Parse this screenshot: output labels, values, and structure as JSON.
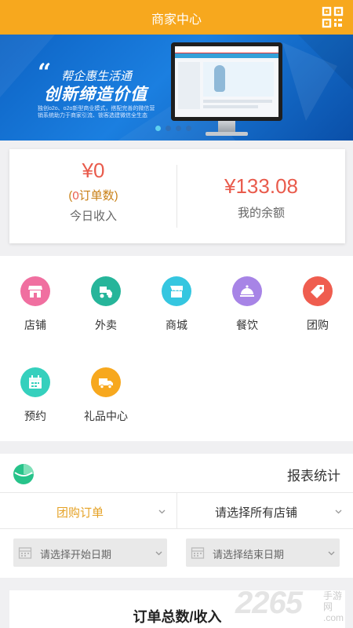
{
  "header": {
    "title": "商家中心",
    "qr_icon": "qr-code-icon"
  },
  "banner": {
    "line1": "帮企惠生活通",
    "line2": "创新缔造价值",
    "desc": "独创o2o、o2o新型商业模式，搭配完善的微信营销系统助力于商家引流、锁客选建微信全生态",
    "slides": 4,
    "active_slide": 0,
    "accent": "#1b7fe0"
  },
  "balance": {
    "today_amount": "¥0",
    "order_count_open": "(",
    "order_count": "0",
    "order_count_suffix": "订单数)",
    "today_label": "今日收入",
    "balance_amount": "¥133.08",
    "balance_label": "我的余额",
    "amount_color": "#e95b4c"
  },
  "menu": [
    {
      "label": "店铺",
      "icon": "shop-icon",
      "color": "#f06fa0"
    },
    {
      "label": "外卖",
      "icon": "delivery-scooter-icon",
      "color": "#26b59a"
    },
    {
      "label": "商城",
      "icon": "storefront-icon",
      "color": "#35c6e0"
    },
    {
      "label": "餐饮",
      "icon": "dish-cover-icon",
      "color": "#a784e6"
    },
    {
      "label": "团购",
      "icon": "tag-icon",
      "color": "#ef5d4f"
    },
    {
      "label": "预约",
      "icon": "calendar-icon",
      "color": "#35d0bd"
    },
    {
      "label": "礼品中心",
      "icon": "truck-icon",
      "color": "#f7a81e"
    }
  ],
  "report": {
    "title": "报表统计",
    "logo_icon": "pie-chart-icon",
    "type_select": "团购订单",
    "store_select": "请选择所有店铺",
    "start_date_placeholder": "请选择开始日期",
    "end_date_placeholder": "请选择结束日期",
    "summary_title": "订单总数/收入"
  },
  "watermark": {
    "number": "2265",
    "site": "手游网",
    "domain": ".com"
  }
}
